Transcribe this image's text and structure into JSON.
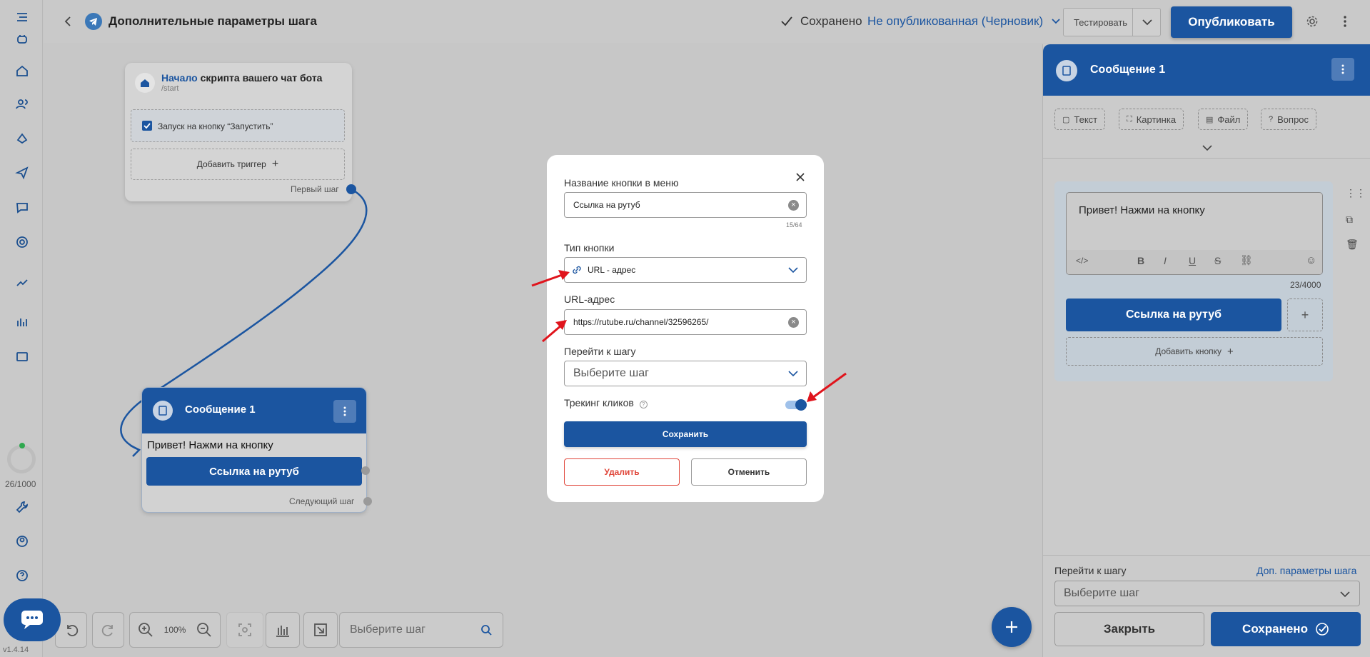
{
  "header": {
    "title": "Дополнительные параметры шага",
    "saved_label": "Сохранено",
    "status_label": "Не опубликованная (Черновик)",
    "test_label": "Тестировать",
    "publish_label": "Опубликовать"
  },
  "sidebar": {
    "counter": "26/1000",
    "version": "v1.4.14"
  },
  "start_node": {
    "title_accent": "Начало",
    "title_rest": " скрипта вашего чат бота",
    "command": "/start",
    "trigger_label": "Запуск на кнопку “Запустить”",
    "add_trigger_label": "Добавить триггер",
    "first_step_label": "Первый шаг"
  },
  "message_node": {
    "title": "Сообщение 1",
    "text": "Привет! Нажми на кнопку",
    "button_label": "Ссылка на рутуб",
    "next_step_label": "Следующий шаг"
  },
  "modal": {
    "name_label": "Название кнопки в меню",
    "name_value": "Ссылка на рутуб",
    "name_counter": "15/64",
    "type_label": "Тип кнопки",
    "type_value": "URL - адрес",
    "url_label": "URL-адрес",
    "url_value": "https://rutube.ru/channel/32596265/",
    "goto_label": "Перейти к шагу",
    "goto_placeholder": "Выберите шаг",
    "tracking_label": "Трекинг кликов",
    "tracking_enabled": true,
    "save_label": "Сохранить",
    "delete_label": "Удалить",
    "cancel_label": "Отменить"
  },
  "right_panel": {
    "title": "Сообщение 1",
    "chips": [
      "Текст",
      "Картинка",
      "Файл",
      "Вопрос"
    ],
    "message_text": "Привет! Нажми на кнопку",
    "char_counter": "23/4000",
    "button_label": "Ссылка на рутуб",
    "add_button_label": "Добавить кнопку",
    "goto_label": "Перейти к шагу",
    "extra_params_link": "Доп. параметры шага",
    "goto_placeholder": "Выберите шаг",
    "close_label": "Закрыть",
    "saved_label": "Сохранено"
  },
  "toolbar": {
    "zoom": "100%",
    "search_placeholder": "Выберите шаг"
  },
  "colors": {
    "brand": "#1b55a0",
    "danger": "#e0463a",
    "arrow": "#e0141c"
  }
}
